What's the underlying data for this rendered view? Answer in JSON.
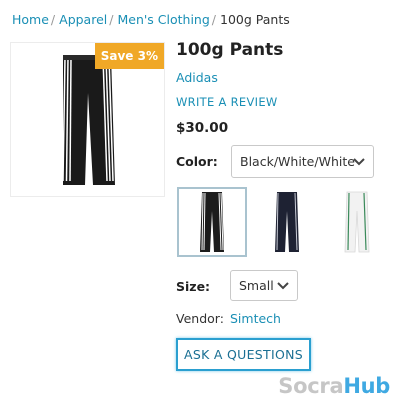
{
  "breadcrumb": {
    "items": [
      "Home",
      "Apparel",
      "Men's Clothing"
    ],
    "separator": "/",
    "current": "100g Pants"
  },
  "product": {
    "title": "100g Pants",
    "brand": "Adidas",
    "review_link": "WRITE A REVIEW",
    "price": "$30.00",
    "badge": "Save 3%"
  },
  "options": {
    "color_label": "Color:",
    "color_value": "Black/White/White",
    "size_label": "Size:",
    "size_value": "Small"
  },
  "thumbnails": [
    {
      "name": "black-white-white",
      "color": "#1c1c1c",
      "stripe": "#ffffff"
    },
    {
      "name": "navy",
      "color": "#1e2233",
      "stripe": "#c9ccd6"
    },
    {
      "name": "white-green",
      "color": "#f2f2f2",
      "stripe": "#3a8a5a"
    }
  ],
  "vendor": {
    "label": "Vendor:",
    "value": "Simtech"
  },
  "actions": {
    "ask_label": "ASK A QUESTIONS"
  },
  "watermark": {
    "part1": "Socra",
    "part2": "Hub"
  },
  "colors": {
    "link": "#1a8fb5",
    "badge": "#f0a827",
    "focus_border": "#2a9fd0"
  }
}
